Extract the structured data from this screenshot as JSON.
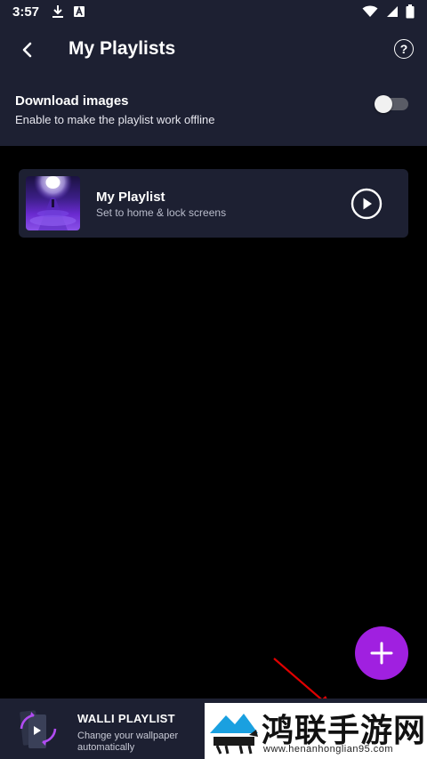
{
  "status_bar": {
    "time": "3:57",
    "icons": [
      "download-icon",
      "notification-a-icon",
      "wifi-icon",
      "signal-icon",
      "battery-icon"
    ]
  },
  "header": {
    "title": "My Playlists",
    "back_icon": "chevron-left-icon",
    "help_icon": "help-circle-icon",
    "help_glyph": "?"
  },
  "download_setting": {
    "title": "Download images",
    "subtitle": "Enable to make the playlist work offline",
    "toggle_on": false
  },
  "playlists": [
    {
      "title": "My Playlist",
      "subtitle": "Set to home & lock screens",
      "action_icon": "play-circle-icon"
    }
  ],
  "fab": {
    "icon": "plus-icon"
  },
  "banner": {
    "title": "WALLI PLAYLIST",
    "subtitle": "Change your wallpaper automatically",
    "icon": "playlist-cycle-icon"
  },
  "watermark": {
    "title": "鸿联手游网",
    "url": "www.henanhonglian95.com"
  },
  "colors": {
    "background": "#000000",
    "surface": "#1d2032",
    "accent": "#a020e0",
    "annotation_arrow": "#e00000"
  }
}
